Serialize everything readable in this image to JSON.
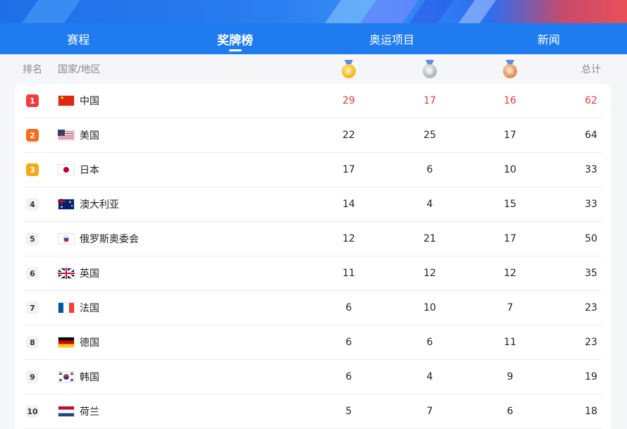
{
  "tabs": [
    {
      "label": "赛程",
      "active": false
    },
    {
      "label": "奖牌榜",
      "active": true
    },
    {
      "label": "奥运项目",
      "active": false
    },
    {
      "label": "新闻",
      "active": false
    }
  ],
  "columns": {
    "rank": "排名",
    "country": "国家/地区",
    "total": "总计",
    "gold_icon": "gold-medal-icon",
    "silver_icon": "silver-medal-icon",
    "bronze_icon": "bronze-medal-icon",
    "gold_glyph": "金",
    "silver_glyph": "银",
    "bronze_glyph": "铜"
  },
  "colors": {
    "accent": "#1f7cf0",
    "highlight": "#e5383b"
  },
  "rows": [
    {
      "rank": "1",
      "country": "中国",
      "flag": "china-flag-icon",
      "gold": "29",
      "silver": "17",
      "bronze": "16",
      "total": "62"
    },
    {
      "rank": "2",
      "country": "美国",
      "flag": "usa-flag-icon",
      "gold": "22",
      "silver": "25",
      "bronze": "17",
      "total": "64"
    },
    {
      "rank": "3",
      "country": "日本",
      "flag": "japan-flag-icon",
      "gold": "17",
      "silver": "6",
      "bronze": "10",
      "total": "33"
    },
    {
      "rank": "4",
      "country": "澳大利亚",
      "flag": "australia-flag-icon",
      "gold": "14",
      "silver": "4",
      "bronze": "15",
      "total": "33"
    },
    {
      "rank": "5",
      "country": "俄罗斯奥委会",
      "flag": "roc-flag-icon",
      "gold": "12",
      "silver": "21",
      "bronze": "17",
      "total": "50"
    },
    {
      "rank": "6",
      "country": "英国",
      "flag": "uk-flag-icon",
      "gold": "11",
      "silver": "12",
      "bronze": "12",
      "total": "35"
    },
    {
      "rank": "7",
      "country": "法国",
      "flag": "france-flag-icon",
      "gold": "6",
      "silver": "10",
      "bronze": "7",
      "total": "23"
    },
    {
      "rank": "8",
      "country": "德国",
      "flag": "germany-flag-icon",
      "gold": "6",
      "silver": "6",
      "bronze": "11",
      "total": "23"
    },
    {
      "rank": "9",
      "country": "韩国",
      "flag": "korea-flag-icon",
      "gold": "6",
      "silver": "4",
      "bronze": "9",
      "total": "19"
    },
    {
      "rank": "10",
      "country": "荷兰",
      "flag": "netherlands-flag-icon",
      "gold": "5",
      "silver": "7",
      "bronze": "6",
      "total": "18"
    }
  ]
}
